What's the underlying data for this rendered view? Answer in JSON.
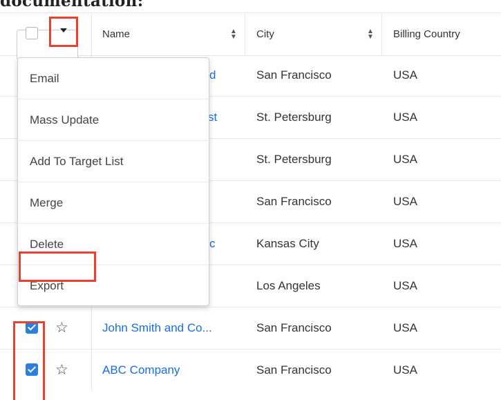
{
  "doc_heading": "documentation:",
  "header": {
    "name_label": "Name",
    "city_label": "City",
    "billing_country_label": "Billing Country",
    "sort_icon": "sort-arrows-icon",
    "caret_icon": "caret-down-icon"
  },
  "dropdown": {
    "items": [
      {
        "label": "Email"
      },
      {
        "label": "Mass Update"
      },
      {
        "label": "Add To Target List"
      },
      {
        "label": "Merge"
      },
      {
        "label": "Delete"
      },
      {
        "label": "Export"
      }
    ]
  },
  "rows": [
    {
      "name_fragment": "d",
      "city": "San Francisco",
      "country": "USA"
    },
    {
      "name_fragment": "st",
      "city": "St. Petersburg",
      "country": "USA"
    },
    {
      "name_fragment": "",
      "city": "St. Petersburg",
      "country": "USA"
    },
    {
      "name_fragment": "",
      "city": "San Francisco",
      "country": "USA"
    },
    {
      "name_fragment": "c",
      "city": "Kansas City",
      "country": "USA"
    },
    {
      "name_fragment": "",
      "city": "Los Angeles",
      "country": "USA"
    },
    {
      "name": "John Smith and Co...",
      "city": "San Francisco",
      "country": "USA",
      "checked": true
    },
    {
      "name": "ABC Company",
      "city": "San Francisco",
      "country": "USA",
      "checked": true
    }
  ],
  "colors": {
    "link": "#176de5",
    "highlight": "#e8412c",
    "checkbox_checked": "#2a7fe0"
  }
}
